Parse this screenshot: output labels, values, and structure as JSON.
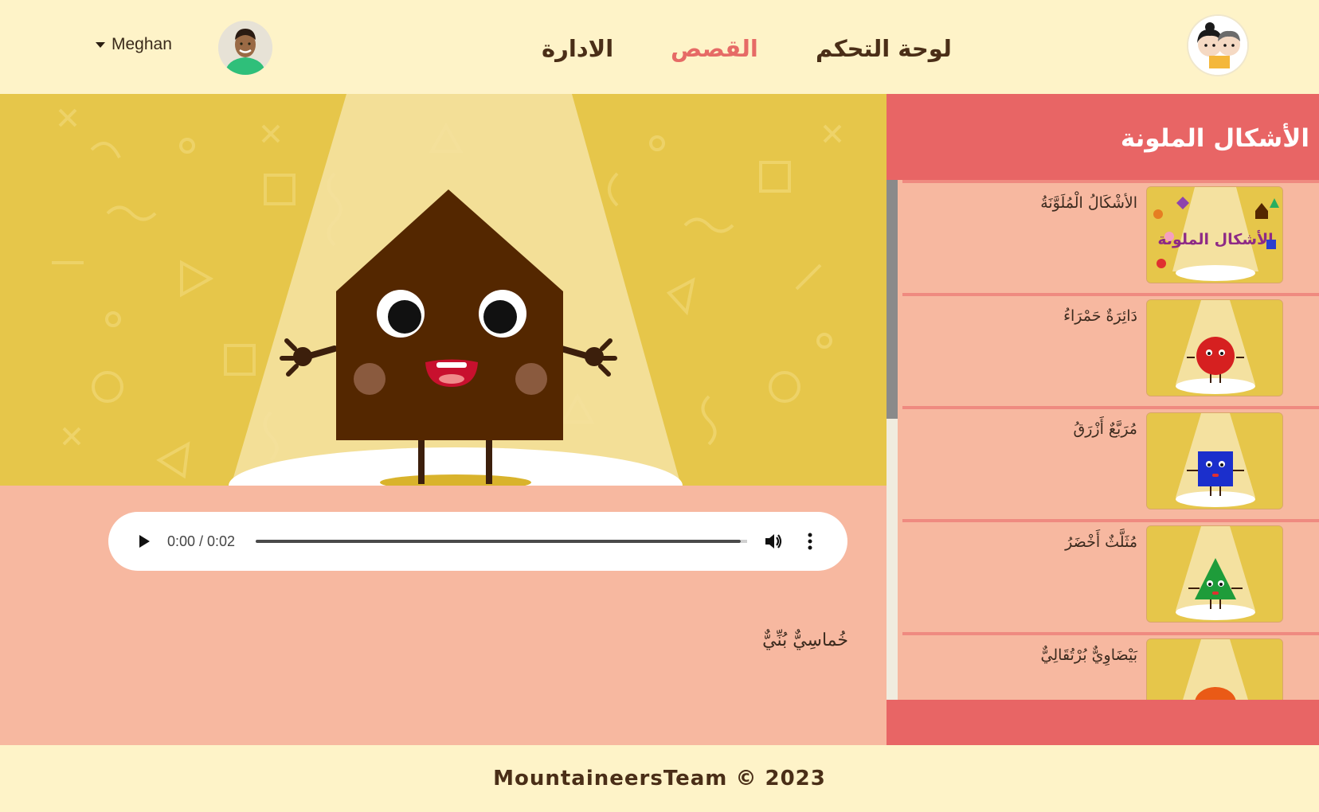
{
  "header": {
    "user_name": "Meghan",
    "nav": {
      "admin": "الادارة",
      "stories": "القصص",
      "dashboard": "لوحة التحكم"
    }
  },
  "player": {
    "time": "0:00 / 0:02",
    "progress": 0,
    "caption": "خُماسِيٌّ بُنِّيٌّ"
  },
  "sidebar": {
    "title": "الأشكال الملونة",
    "items": [
      {
        "label": "الأشْكَالُ الْمُلَوَّنَةُ",
        "shape": "title-card"
      },
      {
        "label": "دَائِرَةٌ حَمْرَاءُ",
        "shape": "red-circle"
      },
      {
        "label": "مُرَبَّعٌ أَزْرَقُ",
        "shape": "blue-square"
      },
      {
        "label": "مُثَلَّثٌ أَخْضَرُ",
        "shape": "green-triangle"
      },
      {
        "label": "بَيْضَاوِيٌّ بُرْتُقَالِيٌّ",
        "shape": "orange-oval"
      }
    ],
    "thumb_title": "الأشكال الملونة"
  },
  "footer": {
    "text": "MountaineersTeam © 2023"
  },
  "colors": {
    "page_bg": "#fef3c8",
    "accent_red": "#e86565",
    "peach": "#f7b8a0",
    "scene_yellow": "#e6c64a",
    "brown": "#4a2e17"
  }
}
